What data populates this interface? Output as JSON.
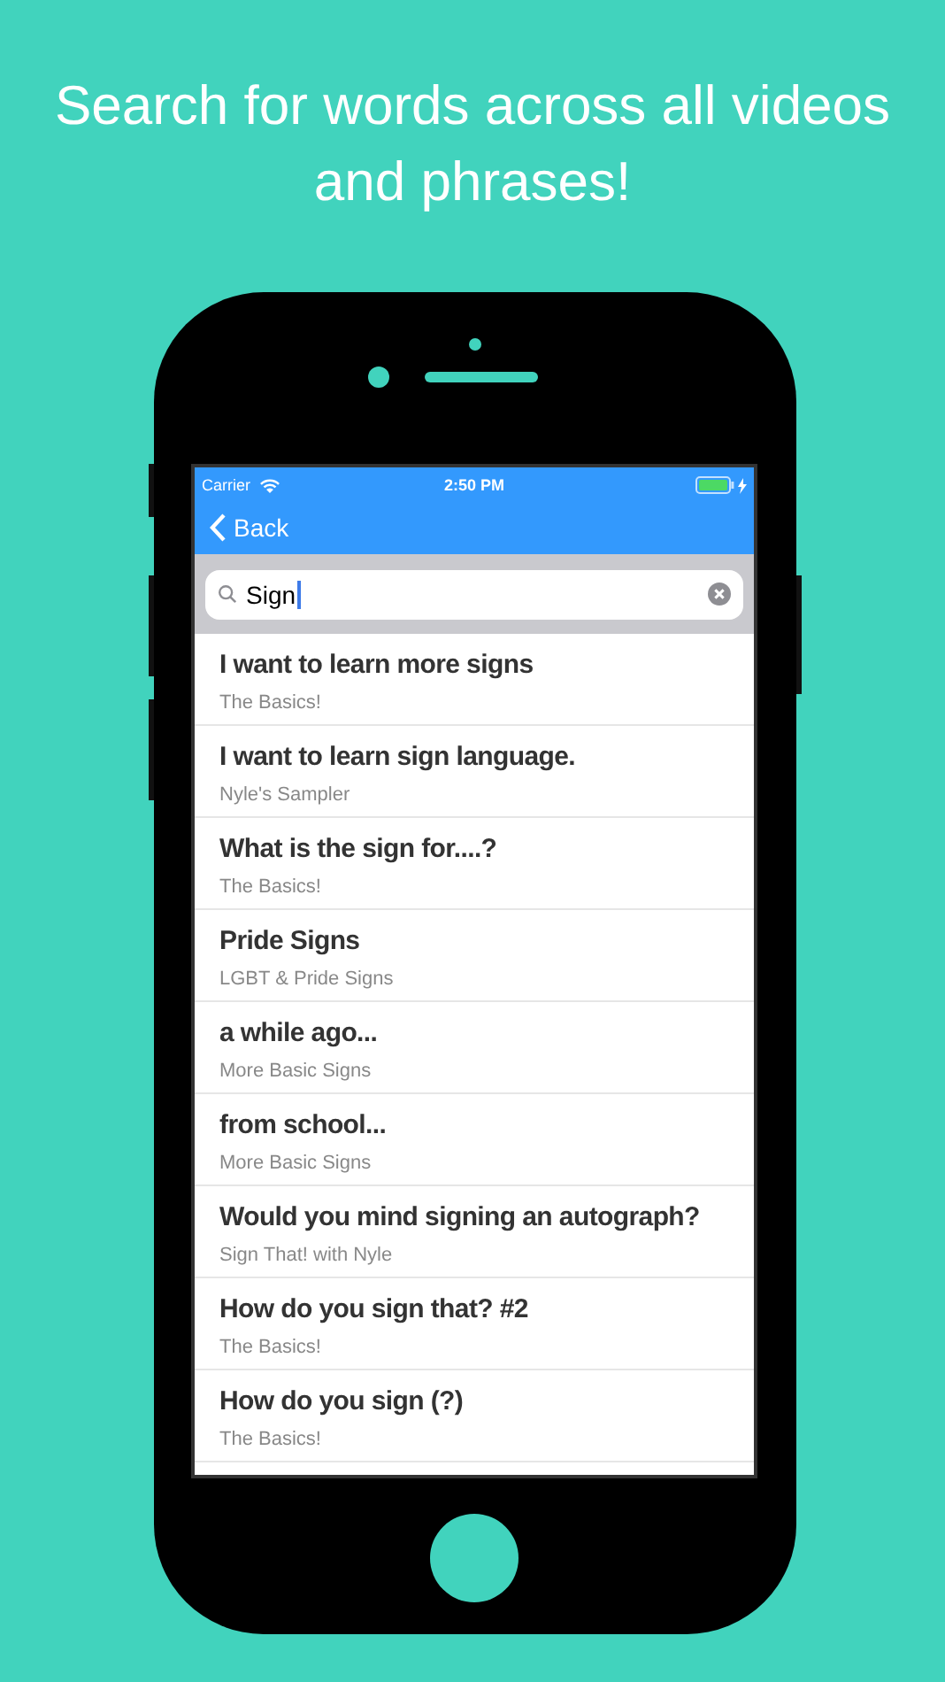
{
  "headline": "Search for words across all videos and phrases!",
  "status_bar": {
    "carrier": "Carrier",
    "time": "2:50 PM"
  },
  "nav_bar": {
    "back": "Back"
  },
  "search": {
    "value": "Sign"
  },
  "results": [
    {
      "title": "I want to learn more signs",
      "subtitle": "The Basics!"
    },
    {
      "title": "I want to learn sign language.",
      "subtitle": "Nyle's Sampler"
    },
    {
      "title": "What is the sign for....?",
      "subtitle": "The Basics!"
    },
    {
      "title": "Pride Signs",
      "subtitle": "LGBT & Pride Signs"
    },
    {
      "title": "a while ago...",
      "subtitle": "More Basic Signs"
    },
    {
      "title": "from school...",
      "subtitle": "More Basic Signs"
    },
    {
      "title": "Would you mind signing an autograph?",
      "subtitle": "Sign That! with Nyle"
    },
    {
      "title": "How do you sign that? #2",
      "subtitle": "The Basics!"
    },
    {
      "title": "How do you sign (?)",
      "subtitle": "The Basics!"
    }
  ]
}
